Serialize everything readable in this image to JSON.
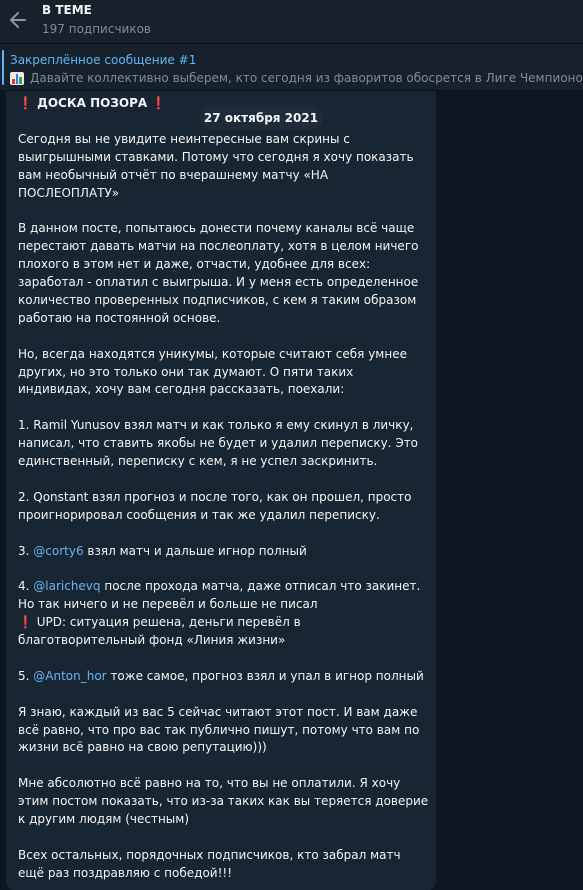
{
  "header": {
    "title": "В ТЕМЕ",
    "subscribers": "197 подписчиков"
  },
  "pinned": {
    "title": "Закреплённое сообщение #1",
    "icon": "bar-chart-icon",
    "text": "Давайте коллективно выберем, кто сегодня из фаворитов обосрется в Лиге Чемпионов"
  },
  "date_badge": "27 октября 2021",
  "message": {
    "heading": "ДОСКА ПОЗОРА",
    "heading_mark": "❗",
    "p1": "Сегодня вы не увидите неинтересные вам скрины с выигрышными ставками. Потому что сегодня я хочу показать вам необычный отчёт по вчерашнему матчу «НА ПОСЛЕОПЛАТУ»",
    "p2": "В данном посте, попытаюсь донести почему каналы всё чаще перестают давать матчи на послеоплату, хотя в целом ничего плохого в этом нет и даже, отчасти, удобнее для всех: заработал - оплатил с выигрыша. И у меня есть определенное количество проверенных подписчиков, с кем я таким образом работаю на постоянной основе.",
    "p3": "Но, всегда находятся уникумы, которые считают себя умнее других, но это только они так думают. О пяти таких индивидах, хочу вам сегодня рассказать, поехали:",
    "item1": "1. Ramil Yunusov взял матч и как только я ему скинул в личку, написал, что ставить якобы не будет и удалил переписку. Это единственный, переписку с кем, я не успел заскринить.",
    "item2": "2. Qonstant взял прогноз и после того, как он прошел, просто проигнорировал сообщения и так же удалил переписку.",
    "item3_prefix": "3. ",
    "item3_mention": "@corty6",
    "item3_text": " взял матч и дальше игнор полный",
    "item4_prefix": "4. ",
    "item4_mention": "@larichevq",
    "item4_text": " после прохода матча, даже отписал что закинет. Но так ничего и не перевёл и больше не писал",
    "item4_upd_mark": "❗",
    "item4_upd": " UPD: ситуация решена, деньги перевёл в благотворительный фонд «Линия жизни»",
    "item5_prefix": "5. ",
    "item5_mention": "@Anton_hor",
    "item5_text": " тоже самое, прогноз взял и упал в игнор полный",
    "p4": "Я знаю, каждый из вас 5 сейчас читают этот пост. И вам даже всё равно, что про вас так публично пишут, потому что вам по жизни всё равно на свою репутацию)))",
    "p5": "Мне абсолютно всё равно на то, что вы не оплатили. Я хочу этим постом показать, что из-за таких как вы теряется доверие к другим людям (честным)",
    "p6": "Всех остальных, порядочных подписчиков, кто забрал матч ещё раз поздравляю с победой!!!"
  },
  "colors": {
    "background": "#0e1621",
    "header": "#17212b",
    "bubble": "#182533",
    "accent": "#5eb5f7",
    "mention": "#6ab3f3",
    "mark": "#e53935"
  }
}
